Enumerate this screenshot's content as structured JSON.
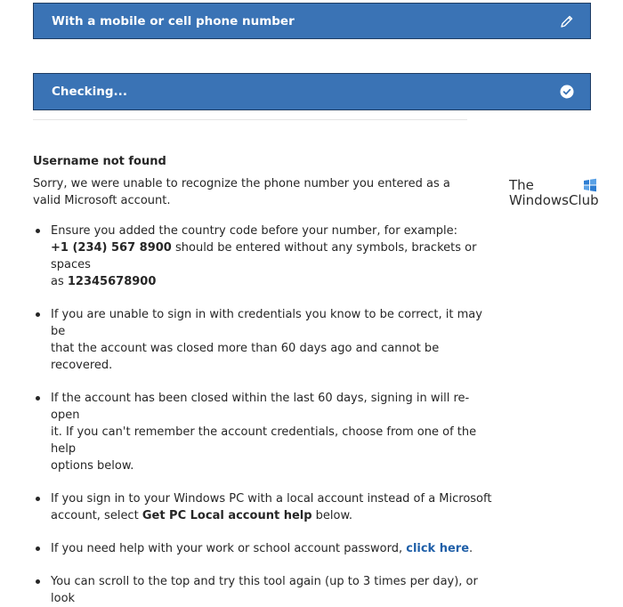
{
  "bar_phone": {
    "label": "With a mobile or cell phone number",
    "icon": "pencil-icon"
  },
  "bar_checking": {
    "label": "Checking...",
    "icon": "check-circle-icon"
  },
  "message": {
    "heading": "Username not found",
    "body_line1": "Sorry, we were unable to recognize the phone number you entered as a",
    "body_line2": "valid Microsoft account."
  },
  "tips": {
    "t1_line1": "Ensure you added the country code before your number, for example:",
    "t1_number": "+1 (234) 567 8900",
    "t1_rest": " should be entered without any symbols, brackets or spaces",
    "t1_as": "as ",
    "t1_digits": "12345678900",
    "t2_line1": "If you are unable to sign in with credentials you know to be correct, it may be",
    "t2_line2": "that the account was closed more than 60 days ago and cannot be recovered.",
    "t3_line1": "If the account has been closed within the last 60 days, signing in will re-open",
    "t3_line2": "it. If you can't remember the account credentials, choose from one of the help",
    "t3_line3": "options below.",
    "t4_line1": "If you sign in to your Windows PC with a local account instead of a Microsoft",
    "t4_pre": "account, select ",
    "t4_bold": "Get PC Local account help",
    "t4_post": " below.",
    "t5_pre": "If you need help with your work or school account password, ",
    "t5_link": "click here",
    "t5_post": ".",
    "t6_line1": "You can scroll to the top and try this tool again (up to 3 times per day), or look"
  },
  "logo": {
    "line1": "The",
    "line2": "WindowsClub",
    "colors": [
      "#2d7dd2",
      "#5aa1e6"
    ]
  },
  "colors": {
    "bar_bg": "#3a73b5",
    "bar_border": "#1f3d63",
    "link": "#1f5fa8"
  }
}
